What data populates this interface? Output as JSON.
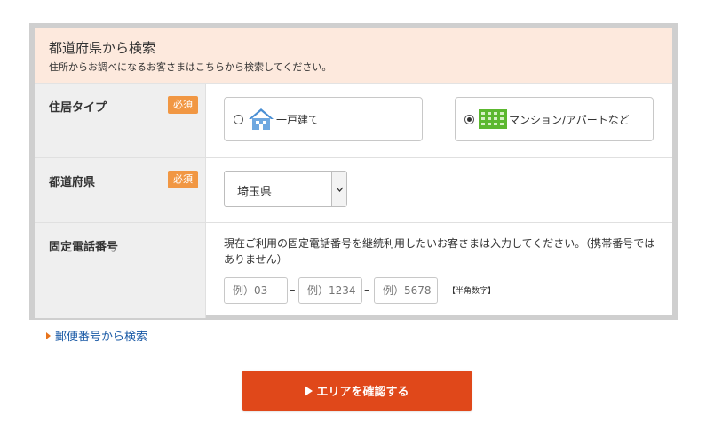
{
  "header": {
    "title": "都道府県から検索",
    "subtitle": "住所からお調べになるお客さまはこちらから検索してください。"
  },
  "required_badge": "必須",
  "housing": {
    "label": "住居タイプ",
    "options": [
      {
        "label": "一戸建て",
        "icon": "house-icon",
        "selected": false
      },
      {
        "label": "マンション/アパートなど",
        "icon": "apartment-icon",
        "selected": true
      }
    ]
  },
  "prefecture": {
    "label": "都道府県",
    "selected": "埼玉県"
  },
  "phone": {
    "label": "固定電話番号",
    "description": "現在ご利用の固定電話番号を継続利用したいお客さまは入力してください。（携帯番号ではありません）",
    "placeholders": [
      "例）03",
      "例）1234",
      "例）5678"
    ],
    "separator": "–",
    "note": "【半角数字】"
  },
  "zip_link": "郵便番号から検索",
  "submit": "エリアを確認する",
  "colors": {
    "header_bg": "#fde9dd",
    "badge": "#f19743",
    "cta": "#e0481a",
    "link": "#1a5aa6"
  }
}
